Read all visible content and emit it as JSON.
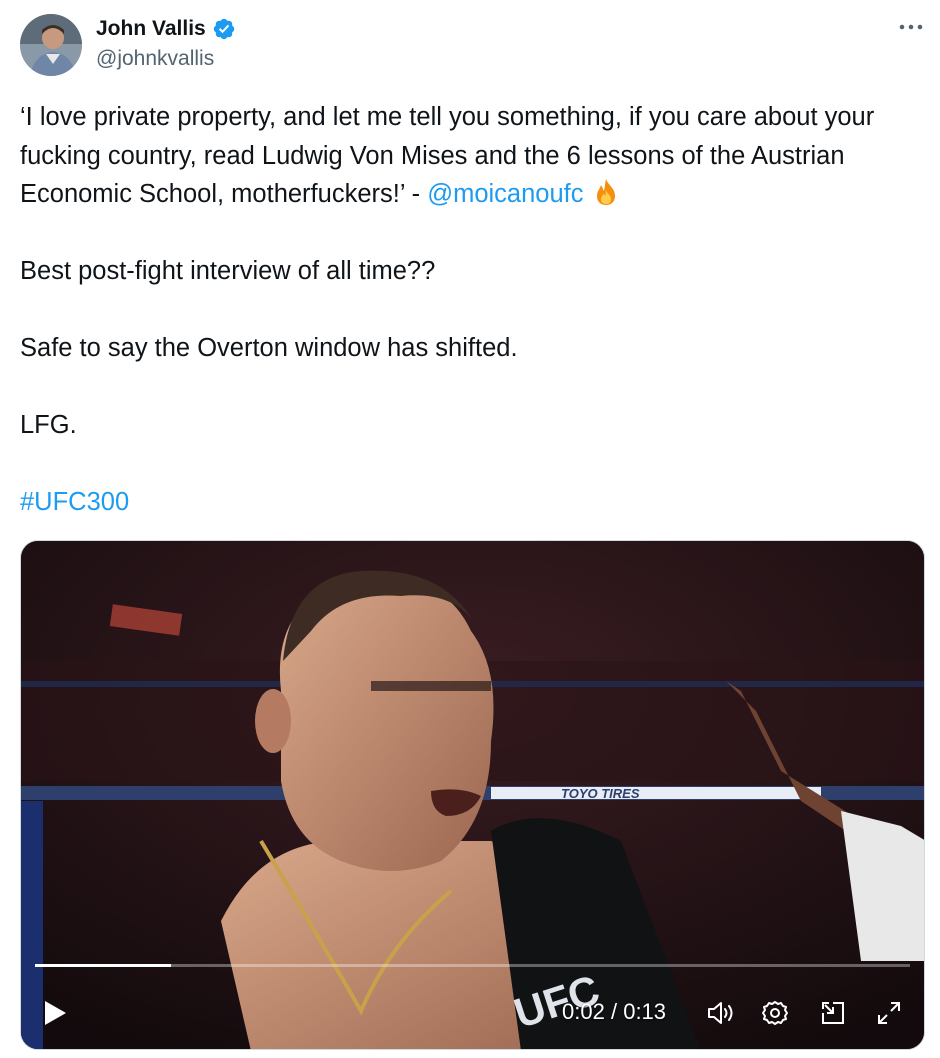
{
  "author": {
    "name": "John Vallis",
    "handle": "@johnkvallis",
    "verified": true,
    "avatar_icon": "profile-avatar"
  },
  "tweet": {
    "quote_text": "‘I love private property, and let me tell you something, if you care about your fucking country, read Ludwig Von Mises and the 6 lessons of the Austrian Economic School, motherfuckers!’ - ",
    "mention": "@moicanoufc",
    "emoji": "fire-icon",
    "line2": "Best post-fight interview of all time??",
    "line3": "Safe to say the Overton window has shifted.",
    "line4": "LFG.",
    "hashtag": "#UFC300"
  },
  "video": {
    "current_time": "0:02",
    "separator": "/",
    "duration": "0:13",
    "progress": 0.155,
    "banner_text": "TOYO TIRES",
    "mic_text": "UFC",
    "controls": [
      "play-icon",
      "volume-icon",
      "settings-icon",
      "picture-in-picture-icon",
      "fullscreen-icon"
    ]
  },
  "colors": {
    "link": "#1d9bf0",
    "verified_badge": "#1d9bf0",
    "secondary_text": "#536471"
  }
}
